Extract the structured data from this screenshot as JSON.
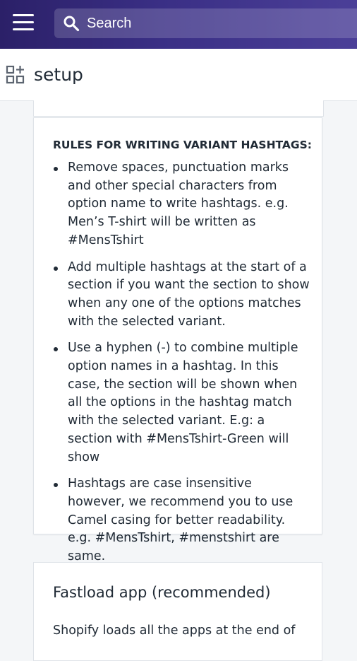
{
  "topbar": {
    "search_placeholder": "Search",
    "menu_icon": "hamburger-menu-icon",
    "search_icon": "search-icon"
  },
  "subheader": {
    "title": "setup",
    "icon": "apps-icon"
  },
  "rules_card": {
    "heading": "RULES FOR WRITING VARIANT HASHTAGS:",
    "items": [
      "Remove spaces, punctuation marks and other special characters from option name to write hashtags. e.g. Men’s T-shirt will be written as #MensTshirt",
      "Add multiple hashtags at the start of a section if you want the section to show when any one of the options matches with the selected variant.",
      "Use a hyphen (-) to combine multiple option names in a hashtag. In this case, the section will be shown when all the options in the hashtag match with the selected variant. E.g: a section with #MensTshirt-Green will show",
      "Hashtags are case insensitive however, we recommend you to use Camel casing for better readability. e.g. #MensTshirt, #menstshirt are same."
    ]
  },
  "fastload_card": {
    "title": "Fastload app (recommended)",
    "text": "Shopify loads all the apps at the end of"
  },
  "colors": {
    "topbar": "#3a2f85",
    "background": "#f4f6f8",
    "text": "#212b36"
  }
}
